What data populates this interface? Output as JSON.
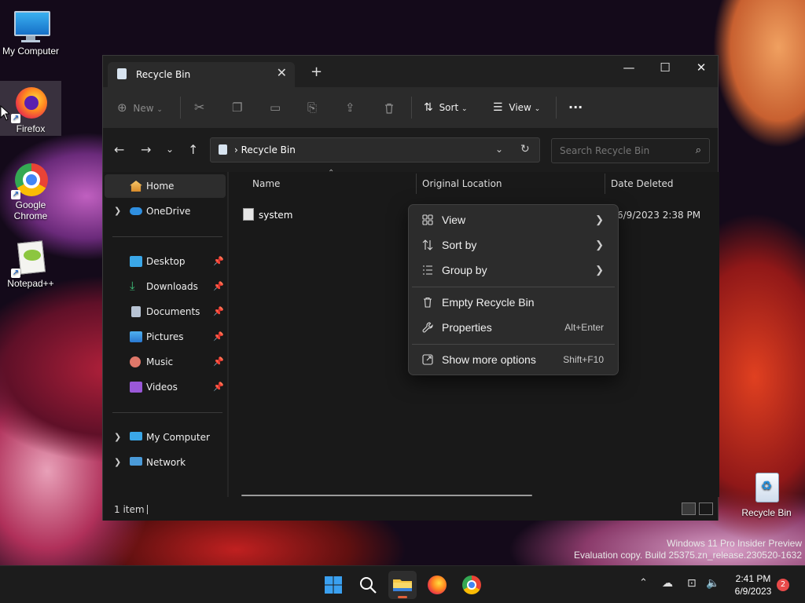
{
  "desktop": {
    "icons": [
      {
        "label": "My Computer"
      },
      {
        "label": "Firefox"
      },
      {
        "label": "Google Chrome"
      },
      {
        "label": "Notepad++"
      },
      {
        "label": "Recycle Bin"
      }
    ],
    "watermark_line1": "Windows 11 Pro Insider Preview",
    "watermark_line2": "Evaluation copy. Build 25375.zn_release.230520-1632"
  },
  "window": {
    "tab_title": "Recycle Bin",
    "toolbar": {
      "new_label": "New",
      "sort_label": "Sort",
      "view_label": "View"
    },
    "address": {
      "path": "Recycle Bin",
      "search_placeholder": "Search Recycle Bin"
    },
    "nav": {
      "items": [
        {
          "label": "Home"
        },
        {
          "label": "OneDrive"
        },
        {
          "label": "Desktop"
        },
        {
          "label": "Downloads"
        },
        {
          "label": "Documents"
        },
        {
          "label": "Pictures"
        },
        {
          "label": "Music"
        },
        {
          "label": "Videos"
        },
        {
          "label": "My Computer"
        },
        {
          "label": "Network"
        }
      ]
    },
    "columns": [
      "Name",
      "Original Location",
      "Date Deleted"
    ],
    "files": [
      {
        "name": "system",
        "date_deleted": "6/9/2023 2:38 PM"
      }
    ],
    "status": "1 item"
  },
  "context_menu": {
    "items": [
      {
        "label": "View",
        "icon": "grid-icon"
      },
      {
        "label": "Sort by",
        "icon": "sort-icon"
      },
      {
        "label": "Group by",
        "icon": "list-icon"
      },
      {
        "label": "Empty Recycle Bin",
        "icon": "trash-icon"
      },
      {
        "label": "Properties",
        "icon": "wrench-icon",
        "shortcut": "Alt+Enter"
      },
      {
        "label": "Show more options",
        "icon": "external-icon",
        "shortcut": "Shift+F10"
      }
    ]
  },
  "taskbar": {
    "time": "2:41 PM",
    "date": "6/9/2023",
    "notification_count": "2"
  },
  "colors": {
    "accent": "#e0603a",
    "window_bg": "#191919",
    "toolbar_bg": "#2b2b2b",
    "menu_bg": "#2c2c2c"
  }
}
